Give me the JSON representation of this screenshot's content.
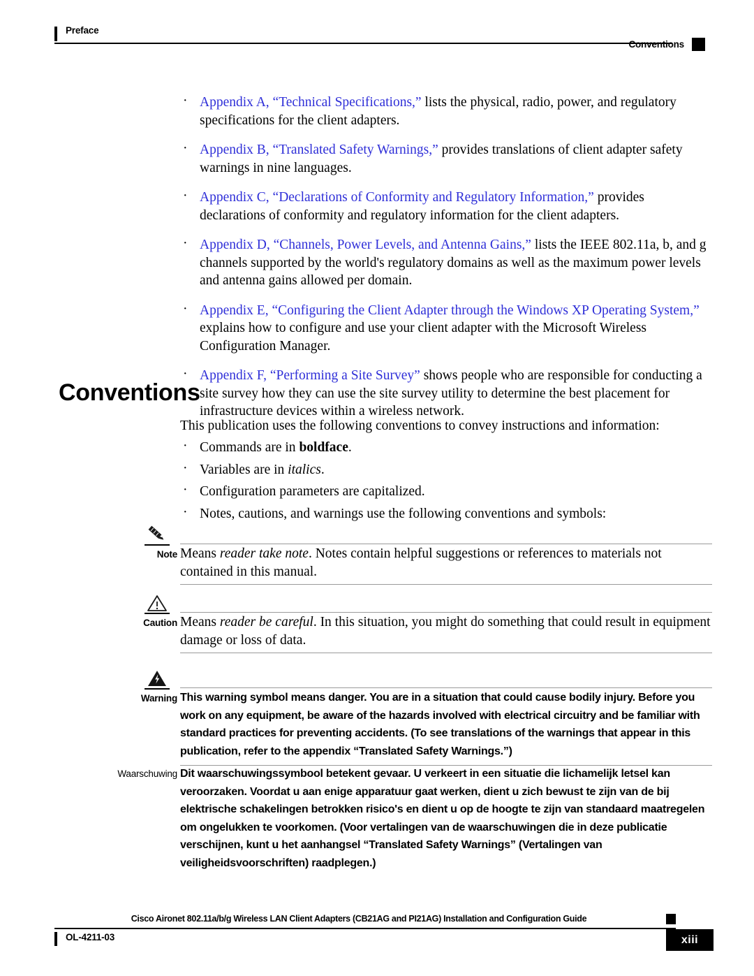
{
  "header": {
    "chapter": "Preface",
    "section": "Conventions"
  },
  "appendix_list": [
    {
      "link": "Appendix A, “Technical Specifications,”",
      "rest": " lists the physical, radio, power, and regulatory specifications for the client adapters."
    },
    {
      "link": "Appendix B, “Translated Safety Warnings,”",
      "rest": " provides translations of client adapter safety warnings in nine languages."
    },
    {
      "link": "Appendix C, “Declarations of Conformity and Regulatory Information,”",
      "rest": " provides declarations of conformity and regulatory information for the client adapters."
    },
    {
      "link": "Appendix D, “Channels, Power Levels, and Antenna Gains,”",
      "rest": " lists the IEEE 802.11a, b, and g channels supported by the world's regulatory domains as well as the maximum power levels and antenna gains allowed per domain."
    },
    {
      "link": "Appendix E, “Configuring the Client Adapter through the Windows XP Operating System,”",
      "rest": " explains how to configure and use your client adapter with the Microsoft Wireless Configuration Manager."
    },
    {
      "link": "Appendix F, “Performing a Site Survey”",
      "rest": " shows people who are responsible for conducting a site survey how they can use the site survey utility to determine the best placement for infrastructure devices within a wireless network."
    }
  ],
  "conventions": {
    "heading": "Conventions",
    "intro": "This publication uses the following conventions to convey instructions and information:",
    "items": [
      {
        "pre": "Commands are in ",
        "bold": "boldface",
        "italic": "",
        "post": "."
      },
      {
        "pre": "Variables are in ",
        "bold": "",
        "italic": "italics",
        "post": "."
      },
      {
        "pre": "Configuration parameters are capitalized.",
        "bold": "",
        "italic": "",
        "post": ""
      },
      {
        "pre": "Notes, cautions, and warnings use the following conventions and symbols:",
        "bold": "",
        "italic": "",
        "post": ""
      }
    ]
  },
  "admonitions": {
    "note": {
      "label": "Note",
      "icon": "pencil-icon",
      "pre": "Means ",
      "italic": "reader take note",
      "post": ". Notes contain helpful suggestions or references to materials not contained in this manual."
    },
    "caution": {
      "label": "Caution",
      "icon": "warning-triangle-icon",
      "pre": "Means ",
      "italic": "reader be careful",
      "post": ". In this situation, you might do something that could result in equipment damage or loss of data."
    },
    "warning": {
      "label": "Warning",
      "icon": "lightning-triangle-icon",
      "text": "This warning symbol means danger. You are in a situation that could cause bodily injury. Before you work on any equipment, be aware of the hazards involved with electrical circuitry and be familiar with standard practices for preventing accidents. (To see translations of the warnings that appear in this publication, refer to the appendix “Translated Safety Warnings.”)"
    },
    "waarschuwing": {
      "label": "Waarschuwing",
      "text": "Dit waarschuwingssymbool betekent gevaar. U verkeert in een situatie die lichamelijk letsel kan veroorzaken. Voordat u aan enige apparatuur gaat werken, dient u zich bewust te zijn van de bij elektrische schakelingen betrokken risico's en dient u op de hoogte te zijn van standaard maatregelen om ongelukken te voorkomen. (Voor vertalingen van de waarschuwingen die in deze publicatie verschijnen, kunt u het aanhangsel “Translated Safety Warnings” (Vertalingen van veiligheidsvoorschriften) raadplegen.)"
    }
  },
  "footer": {
    "title": "Cisco Aironet 802.11a/b/g Wireless LAN Client Adapters (CB21AG and PI21AG) Installation and Configuration Guide",
    "doc_id": "OL-4211-03",
    "page_number": "xiii"
  },
  "colors": {
    "link_blue": "#2f2fd8",
    "rule_gray": "#9a9a9a",
    "ink_black": "#000000"
  }
}
